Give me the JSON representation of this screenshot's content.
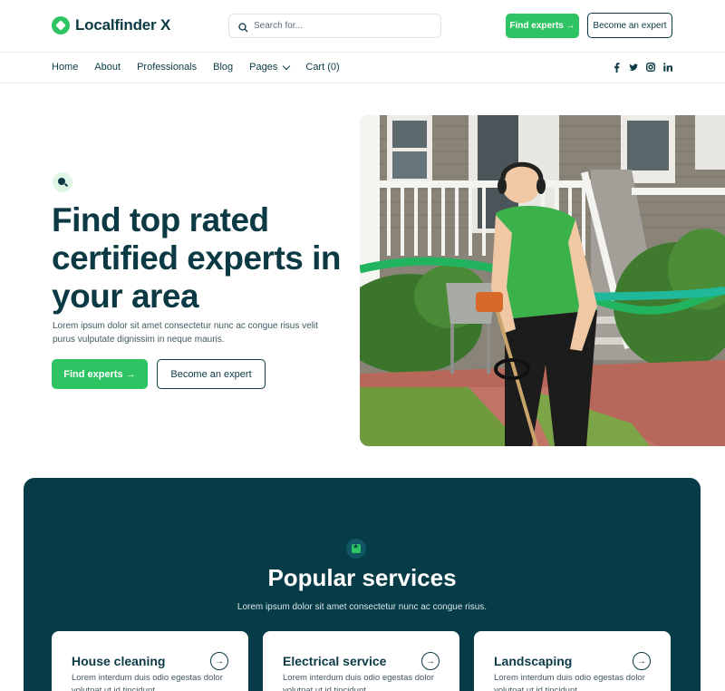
{
  "brand": {
    "name": "Localfinder X",
    "accent": "#2fc463",
    "dark": "#063c48"
  },
  "search": {
    "placeholder": "Search for..."
  },
  "header": {
    "find_label": "Find experts →",
    "become_label": "Become an expert"
  },
  "nav": {
    "items": [
      {
        "label": "Home"
      },
      {
        "label": "About"
      },
      {
        "label": "Professionals"
      },
      {
        "label": "Blog"
      },
      {
        "label": "Pages"
      },
      {
        "label": "Cart (0)"
      }
    ],
    "social": [
      "facebook-icon",
      "twitter-icon",
      "instagram-icon",
      "linkedin-icon"
    ]
  },
  "hero": {
    "title": "Find top rated certified experts in your area",
    "subtitle": "Lorem ipsum dolor sit amet consectetur nunc ac congue risus velit purus vulputate dignissim in neque mauris.",
    "find_label": "Find experts →",
    "become_label": "Become an expert"
  },
  "services": {
    "title": "Popular services",
    "subtitle": "Lorem ipsum dolor sit amet consectetur nunc ac congue risus.",
    "cards": [
      {
        "title": "House cleaning",
        "text": "Lorem interdum duis odio egestas dolor volutpat ut id tincidunt"
      },
      {
        "title": "Electrical service",
        "text": "Lorem interdum duis odio egestas dolor volutpat ut id tincidunt"
      },
      {
        "title": "Landscaping",
        "text": "Lorem interdum duis odio egestas dolor volutpat ut id tincidunt"
      }
    ]
  }
}
